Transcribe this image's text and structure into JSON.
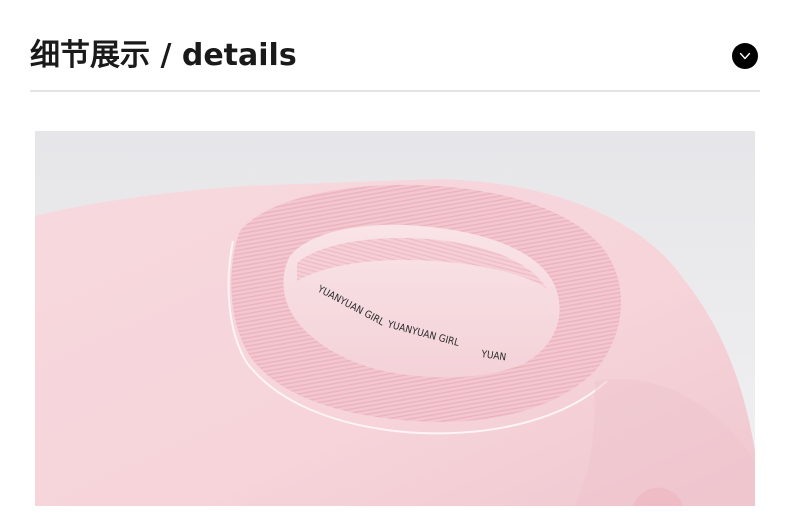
{
  "section": {
    "title": "细节展示 / details"
  },
  "icons": {
    "expand": "chevron-down-icon"
  },
  "photo": {
    "collar_label_1": "YUANYUAN GIRL",
    "collar_label_2": "YUANYUAN GIRL",
    "collar_label_3": "YUAN",
    "colors": {
      "background": "#ececee",
      "garment": "#f6d6db",
      "ribbing": "#f3c7ce"
    }
  }
}
